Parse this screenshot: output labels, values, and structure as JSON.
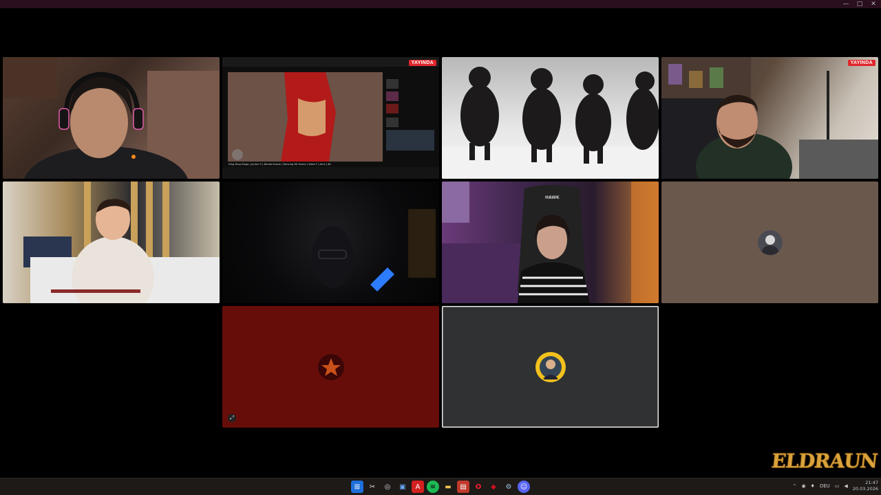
{
  "window": {
    "controls": [
      "—",
      "□",
      "✕"
    ]
  },
  "tiles": {
    "t2": {
      "badge": "YAYINDA",
      "video_title": "Ding Ding Dingo | Jurijuri 5 | Nirmal Kumar | Dancing Hit Scene | Vikas F | Aa b | 4K Video | TO Ganda"
    },
    "t4": {
      "badge": "YAYINDA"
    },
    "t7": {
      "chair_brand": "HAWK"
    }
  },
  "logo": {
    "text": "ELDRAUN"
  },
  "taskbar": {
    "language": "DEU",
    "time": "21:47",
    "date": "20.03.2026"
  }
}
